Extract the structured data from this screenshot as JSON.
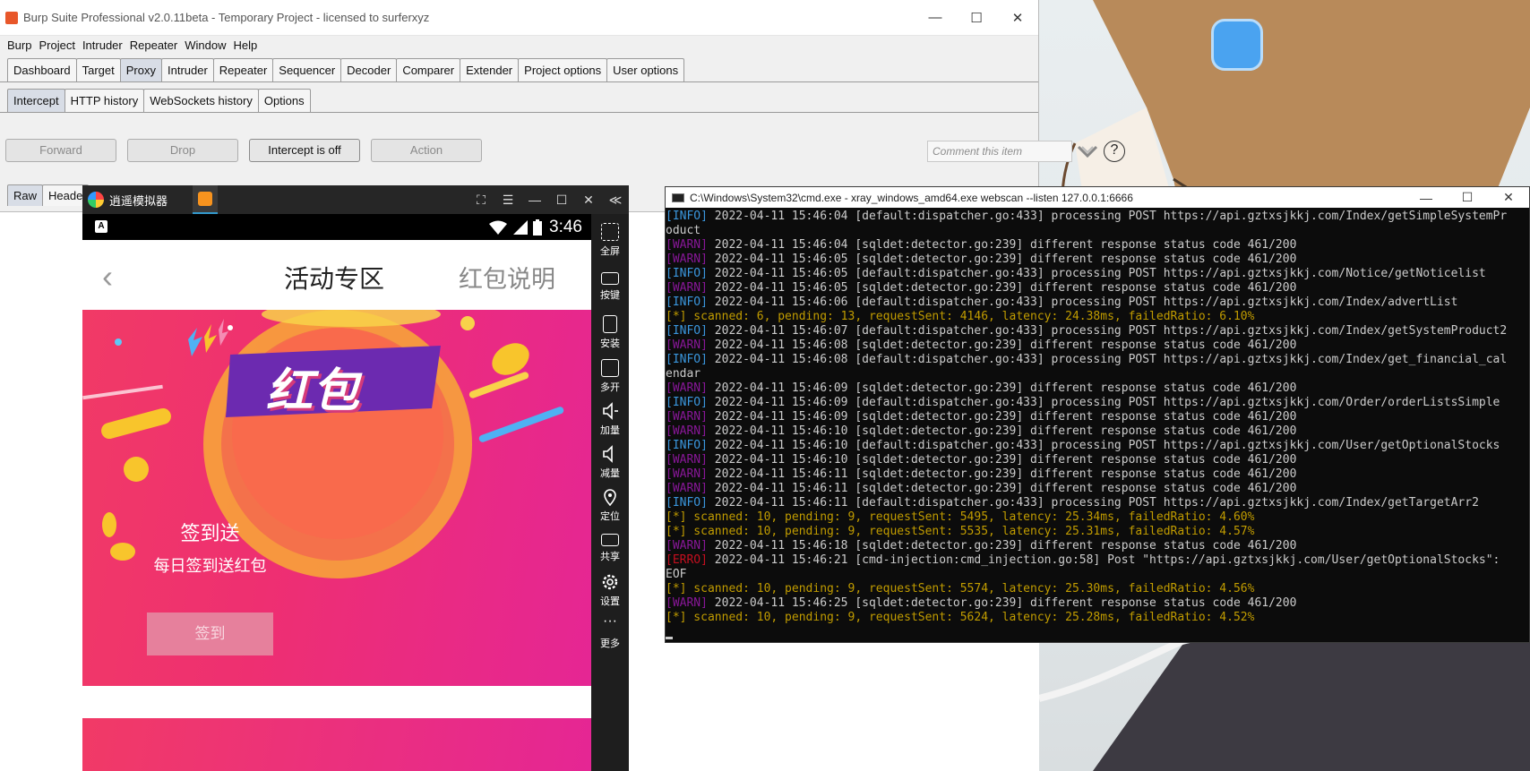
{
  "burp": {
    "window_title": "Burp Suite Professional v2.0.11beta - Temporary Project - licensed to surferxyz",
    "menu": [
      "Burp",
      "Project",
      "Intruder",
      "Repeater",
      "Window",
      "Help"
    ],
    "tabs": [
      "Dashboard",
      "Target",
      "Proxy",
      "Intruder",
      "Repeater",
      "Sequencer",
      "Decoder",
      "Comparer",
      "Extender",
      "Project options",
      "User options"
    ],
    "selected_tab": "Proxy",
    "subtabs": [
      "Intercept",
      "HTTP history",
      "WebSockets history",
      "Options"
    ],
    "selected_subtab": "Intercept",
    "buttons": {
      "forward": "Forward",
      "drop": "Drop",
      "intercept": "Intercept is off",
      "action": "Action"
    },
    "comment_placeholder": "Comment this item",
    "help_icon": "?",
    "editor_tabs": [
      "Raw",
      "Heade"
    ]
  },
  "emulator": {
    "title": "逍遥模拟器",
    "window_controls": [
      "⛶",
      "☰",
      "—",
      "☐",
      "✕",
      "≪"
    ],
    "status_time": "3:46",
    "status_key": "A",
    "page_title": "活动专区",
    "right_action": "红包说明",
    "back": "‹",
    "banner_text": "红包",
    "sign_title": "签到送",
    "sign_subtitle": "每日签到送红包",
    "sign_button": "签到",
    "sidebar": [
      {
        "label": "全屏",
        "icon": "fullscreen-icon"
      },
      {
        "label": "按键",
        "icon": "keyboard-icon"
      },
      {
        "label": "安装",
        "icon": "apk-install-icon"
      },
      {
        "label": "多开",
        "icon": "multi-instance-icon"
      },
      {
        "label": "加量",
        "icon": "volume-up-icon"
      },
      {
        "label": "减量",
        "icon": "volume-down-icon"
      },
      {
        "label": "定位",
        "icon": "location-icon"
      },
      {
        "label": "共享",
        "icon": "folder-share-icon"
      },
      {
        "label": "设置",
        "icon": "gear-icon"
      },
      {
        "label": "更多",
        "icon": "more-icon"
      }
    ]
  },
  "cmd": {
    "title": "C:\\Windows\\System32\\cmd.exe - xray_windows_amd64.exe  webscan --listen 127.0.0.1:6666",
    "lines": [
      {
        "tag": "[INFO]",
        "kind": "info",
        "text": " 2022-04-11 15:46:04 [default:dispatcher.go:433] processing POST https://api.gztxsjkkj.com/Index/getSimpleSystemPr"
      },
      {
        "tag": "",
        "kind": "plain",
        "text": "oduct"
      },
      {
        "tag": "[WARN]",
        "kind": "warn",
        "text": " 2022-04-11 15:46:04 [sqldet:detector.go:239] different response status code 461/200"
      },
      {
        "tag": "[WARN]",
        "kind": "warn",
        "text": " 2022-04-11 15:46:05 [sqldet:detector.go:239] different response status code 461/200"
      },
      {
        "tag": "[INFO]",
        "kind": "info",
        "text": " 2022-04-11 15:46:05 [default:dispatcher.go:433] processing POST https://api.gztxsjkkj.com/Notice/getNoticelist"
      },
      {
        "tag": "[WARN]",
        "kind": "warn",
        "text": " 2022-04-11 15:46:05 [sqldet:detector.go:239] different response status code 461/200"
      },
      {
        "tag": "[INFO]",
        "kind": "info",
        "text": " 2022-04-11 15:46:06 [default:dispatcher.go:433] processing POST https://api.gztxsjkkj.com/Index/advertList"
      },
      {
        "tag": "[*]",
        "kind": "scan",
        "text": " scanned: 6, pending: 13, requestSent: 4146, latency: 24.38ms, failedRatio: 6.10%"
      },
      {
        "tag": "[INFO]",
        "kind": "info",
        "text": " 2022-04-11 15:46:07 [default:dispatcher.go:433] processing POST https://api.gztxsjkkj.com/Index/getSystemProduct2"
      },
      {
        "tag": "[WARN]",
        "kind": "warn",
        "text": " 2022-04-11 15:46:08 [sqldet:detector.go:239] different response status code 461/200"
      },
      {
        "tag": "[INFO]",
        "kind": "info",
        "text": " 2022-04-11 15:46:08 [default:dispatcher.go:433] processing POST https://api.gztxsjkkj.com/Index/get_financial_cal"
      },
      {
        "tag": "",
        "kind": "plain",
        "text": "endar"
      },
      {
        "tag": "[WARN]",
        "kind": "warn",
        "text": " 2022-04-11 15:46:09 [sqldet:detector.go:239] different response status code 461/200"
      },
      {
        "tag": "[INFO]",
        "kind": "info",
        "text": " 2022-04-11 15:46:09 [default:dispatcher.go:433] processing POST https://api.gztxsjkkj.com/Order/orderListsSimple"
      },
      {
        "tag": "[WARN]",
        "kind": "warn",
        "text": " 2022-04-11 15:46:09 [sqldet:detector.go:239] different response status code 461/200"
      },
      {
        "tag": "[WARN]",
        "kind": "warn",
        "text": " 2022-04-11 15:46:10 [sqldet:detector.go:239] different response status code 461/200"
      },
      {
        "tag": "[INFO]",
        "kind": "info",
        "text": " 2022-04-11 15:46:10 [default:dispatcher.go:433] processing POST https://api.gztxsjkkj.com/User/getOptionalStocks"
      },
      {
        "tag": "[WARN]",
        "kind": "warn",
        "text": " 2022-04-11 15:46:10 [sqldet:detector.go:239] different response status code 461/200"
      },
      {
        "tag": "[WARN]",
        "kind": "warn",
        "text": " 2022-04-11 15:46:11 [sqldet:detector.go:239] different response status code 461/200"
      },
      {
        "tag": "[WARN]",
        "kind": "warn",
        "text": " 2022-04-11 15:46:11 [sqldet:detector.go:239] different response status code 461/200"
      },
      {
        "tag": "[INFO]",
        "kind": "info",
        "text": " 2022-04-11 15:46:11 [default:dispatcher.go:433] processing POST https://api.gztxsjkkj.com/Index/getTargetArr2"
      },
      {
        "tag": "[*]",
        "kind": "scan",
        "text": " scanned: 10, pending: 9, requestSent: 5495, latency: 25.34ms, failedRatio: 4.60%"
      },
      {
        "tag": "[*]",
        "kind": "scan",
        "text": " scanned: 10, pending: 9, requestSent: 5535, latency: 25.31ms, failedRatio: 4.57%"
      },
      {
        "tag": "[WARN]",
        "kind": "warn",
        "text": " 2022-04-11 15:46:18 [sqldet:detector.go:239] different response status code 461/200"
      },
      {
        "tag": "[ERRO]",
        "kind": "erro",
        "text": " 2022-04-11 15:46:21 [cmd-injection:cmd_injection.go:58] Post \"https://api.gztxsjkkj.com/User/getOptionalStocks\":"
      },
      {
        "tag": "",
        "kind": "plain",
        "text": "EOF"
      },
      {
        "tag": "[*]",
        "kind": "scan",
        "text": " scanned: 10, pending: 9, requestSent: 5574, latency: 25.30ms, failedRatio: 4.56%"
      },
      {
        "tag": "[WARN]",
        "kind": "warn",
        "text": " 2022-04-11 15:46:25 [sqldet:detector.go:239] different response status code 461/200"
      },
      {
        "tag": "[*]",
        "kind": "scan",
        "text": " scanned: 10, pending: 9, requestSent: 5624, latency: 25.28ms, failedRatio: 4.52%"
      }
    ]
  },
  "colors": {
    "info": "#3a96dd",
    "warn": "#881798",
    "erro": "#c50f1f",
    "scan": "#c19c00",
    "banner": "#ee2f71"
  }
}
